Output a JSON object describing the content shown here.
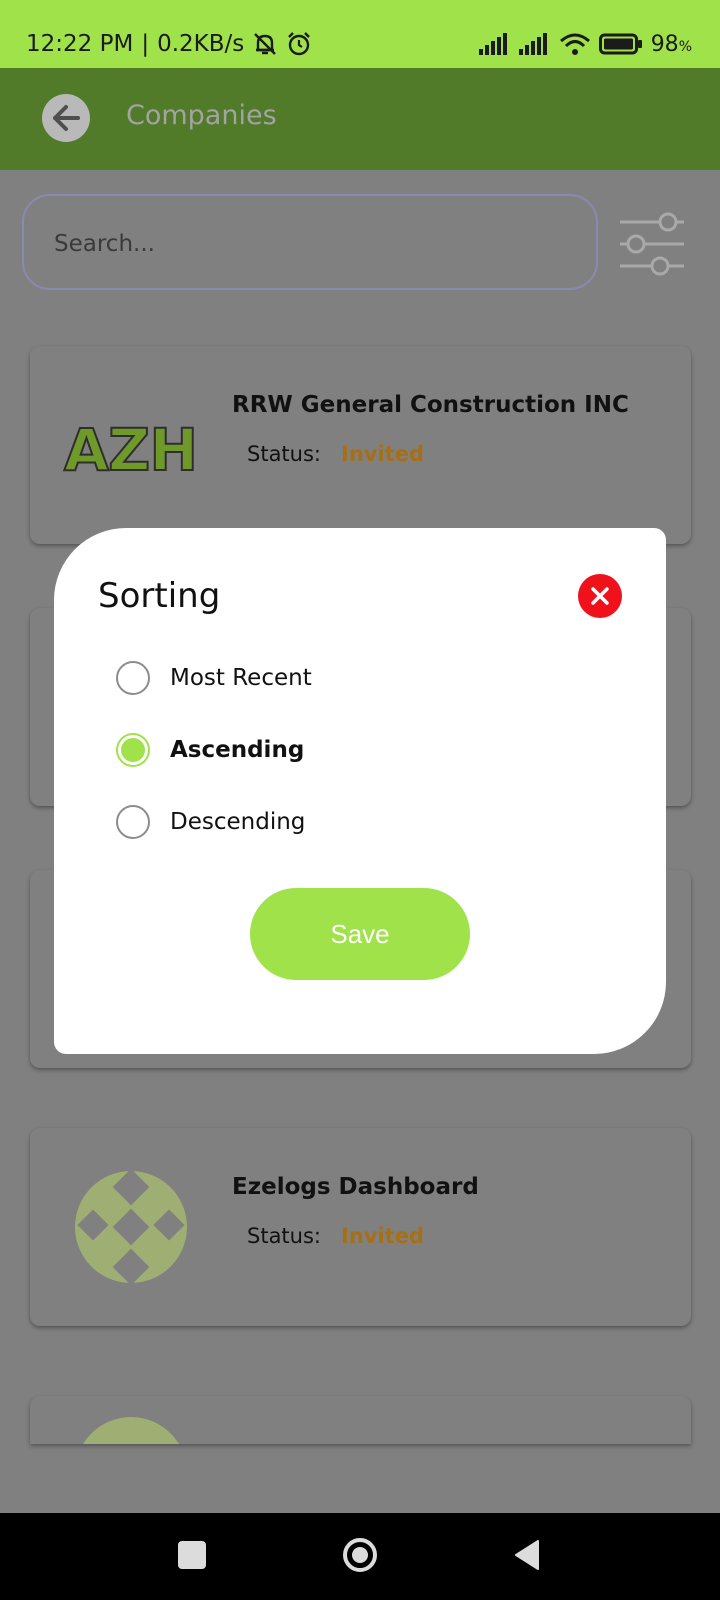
{
  "status_bar": {
    "time": "12:22 PM",
    "network_speed": "0.2KB/s",
    "battery": "98",
    "battery_unit": "%",
    "icons": [
      "mute-bell-icon",
      "alarm-icon",
      "signal-icon",
      "signal-icon",
      "wifi-icon",
      "battery-icon"
    ]
  },
  "app_bar": {
    "title": "Companies",
    "back_icon": "arrow-left-icon"
  },
  "search": {
    "placeholder": "Search...",
    "value": "",
    "filter_icon": "sliders-icon"
  },
  "companies": [
    {
      "name": "RRW General Construction INC",
      "status_label": "Status:",
      "status": "Invited",
      "logo_text": "AZH"
    },
    {
      "name": "Ezelogs Dashboard",
      "status_label": "Status:",
      "status": "Invited"
    }
  ],
  "dialog": {
    "title": "Sorting",
    "close_icon": "close-icon",
    "options": [
      {
        "label": "Most Recent",
        "selected": false
      },
      {
        "label": "Ascending",
        "selected": true
      },
      {
        "label": "Descending",
        "selected": false
      }
    ],
    "save_label": "Save"
  },
  "nav_bar": {
    "icons": [
      "square-icon",
      "home-circle-icon",
      "back-triangle-icon"
    ]
  },
  "colors": {
    "accent": "#9fe24a",
    "app_bar": "#517a29",
    "status_invited": "#a86f12",
    "close": "#f0121b"
  }
}
